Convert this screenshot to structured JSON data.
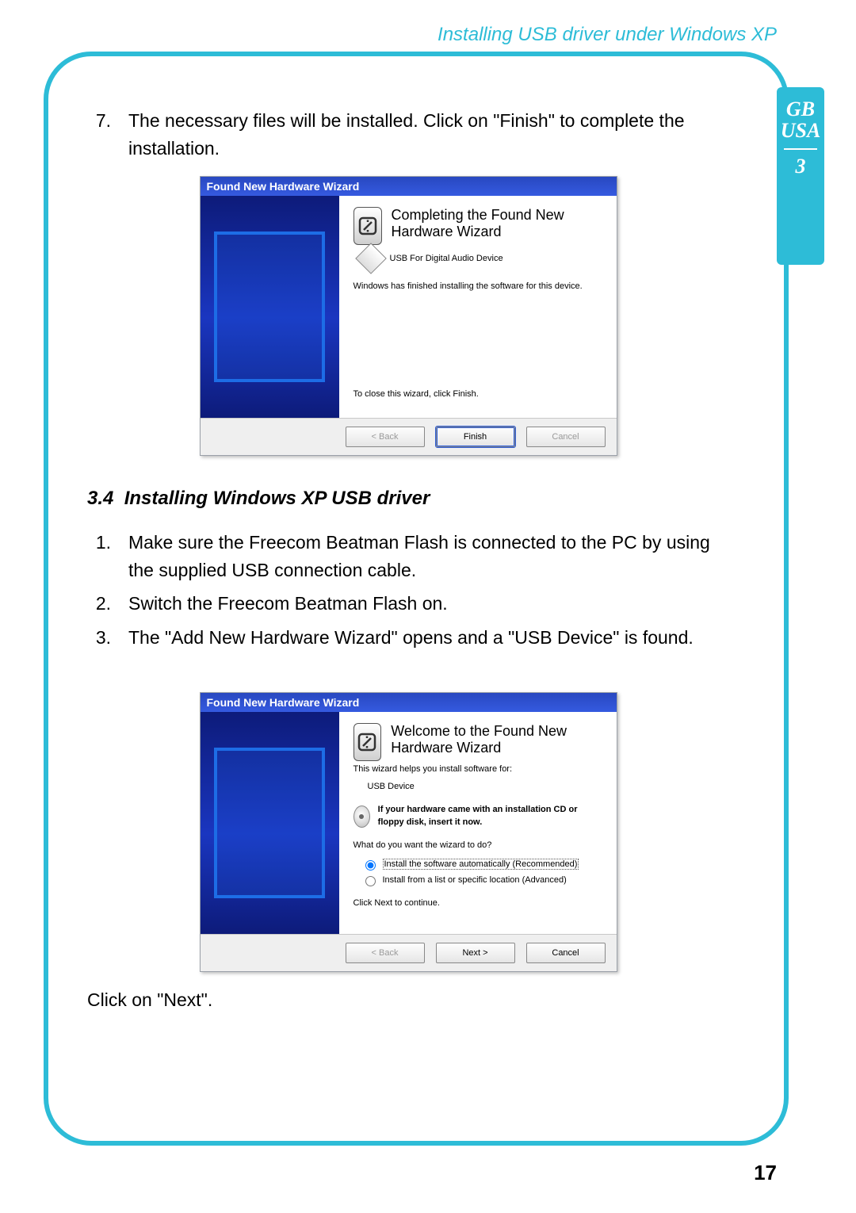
{
  "header": {
    "title": "Installing USB driver under Windows XP"
  },
  "side_tab": {
    "line1": "GB",
    "line2": "USA",
    "section": "3"
  },
  "page_number": "17",
  "step7": {
    "number": "7.",
    "text": "The necessary files will be installed. Click on \"Finish\" to complete the installation."
  },
  "wizard_finish": {
    "title": "Found New Hardware Wizard",
    "heading": "Completing the Found New Hardware Wizard",
    "device_label": "USB For Digital Audio Device",
    "status": "Windows has finished installing the software for this device.",
    "close_hint": "To close this wizard, click Finish.",
    "btn_back": "< Back",
    "btn_finish": "Finish",
    "btn_cancel": "Cancel"
  },
  "subsection": {
    "number": "3.4",
    "title": "Installing Windows XP USB driver"
  },
  "steps": {
    "s1n": "1.",
    "s1": "Make sure the Freecom Beatman Flash is connected to the PC by using the supplied USB connection cable.",
    "s2n": "2.",
    "s2": "Switch the Freecom Beatman Flash on.",
    "s3n": "3.",
    "s3": "The \"Add New Hardware Wizard\" opens and a \"USB Device\" is found."
  },
  "wizard_welcome": {
    "title": "Found New Hardware Wizard",
    "heading": "Welcome to the Found New Hardware Wizard",
    "intro": "This wizard helps you install software for:",
    "device_label": "USB Device",
    "cd_hint": "If your hardware came with an installation CD or floppy disk, insert it now.",
    "question": "What do you want the wizard to do?",
    "opt1": "Install the software automatically (Recommended)",
    "opt2": "Install from a list or specific location (Advanced)",
    "continue_hint": "Click Next to continue.",
    "btn_back": "< Back",
    "btn_next": "Next >",
    "btn_cancel": "Cancel"
  },
  "after_text": "Click on \"Next\"."
}
